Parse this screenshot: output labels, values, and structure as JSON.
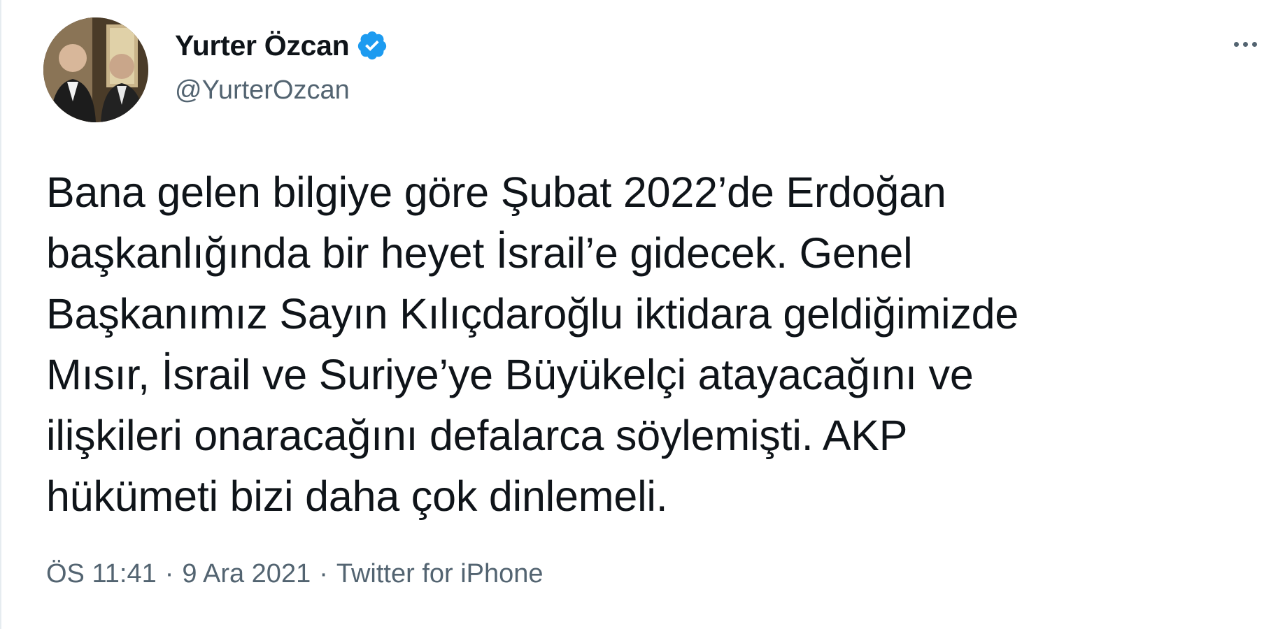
{
  "author": {
    "display_name": "Yurter Özcan",
    "handle": "@YurterOzcan",
    "verified": true,
    "verified_color": "#1d9bf0"
  },
  "icons": {
    "verified": "verified-badge-icon",
    "more": "more-options-icon"
  },
  "tweet": {
    "lines": [
      "Bana gelen bilgiye göre Şubat 2022’de Erdoğan",
      "başkanlığında bir heyet İsrail’e gidecek. Genel",
      "Başkanımız Sayın Kılıçdaroğlu iktidara geldiğimizde",
      "Mısır, İsrail ve Suriye’ye Büyükelçi atayacağını ve",
      "ilişkileri onaracağını defalarca söylemişti. AKP",
      "hükümeti bizi daha çok dinlemeli."
    ]
  },
  "meta": {
    "time": "ÖS 11:41",
    "separator_1": "·",
    "date": "9 Ara 2021",
    "separator_2": "·",
    "source": "Twitter for iPhone"
  },
  "colors": {
    "text_primary": "#0f1419",
    "text_secondary": "#536471",
    "background": "#ffffff"
  }
}
